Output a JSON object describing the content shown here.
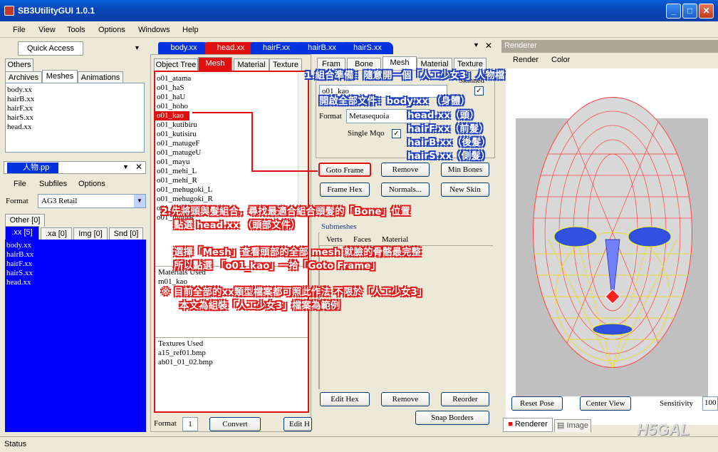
{
  "window": {
    "title": "SB3UtilityGUI 1.0.1",
    "min": "_",
    "max": "□",
    "close": "✕"
  },
  "menu": [
    "File",
    "View",
    "Tools",
    "Options",
    "Windows",
    "Help"
  ],
  "quick_access": {
    "title": "Quick Access",
    "tabs": [
      "Others",
      "Archives",
      "Meshes",
      "Animations"
    ],
    "items": [
      "body.xx",
      "hairB.xx",
      "hairF.xx",
      "hairS.xx",
      "head.xx"
    ]
  },
  "pp": {
    "title": "人物.pp",
    "menu": [
      "File",
      "Subfiles",
      "Options"
    ],
    "format_label": "Format",
    "format_value": "AG3 Retail",
    "tabs": [
      "Other [0]",
      ".xx [5]",
      ".xa [0]",
      "Img [0]",
      "Snd [0]"
    ],
    "items": [
      "body.xx",
      "hairB.xx",
      "hairF.xx",
      "hairS.xx",
      "head.xx"
    ]
  },
  "doc_tabs": [
    "body.xx",
    "head.xx",
    "hairF.xx",
    "hairB.xx",
    "hairS.xx"
  ],
  "editor": {
    "tabs": [
      "Object Tree",
      "Mesh",
      "Material",
      "Texture"
    ],
    "mesh_list": [
      "o01_atama",
      "o01_haS",
      "o01_haU",
      "o01_hoho",
      "o01_kao",
      "o01_kutibiru",
      "o01_kutisiru",
      "o01_matugeF",
      "o01_matugeU",
      "o01_mayu",
      "o01_mehi_L",
      "o01_mehi_R",
      "o01_mehugoki_L",
      "o01_mehugoki_R",
      "o01_mimiL",
      "o01_mimiR"
    ],
    "materials_label": "Materials Used",
    "materials": [
      "m01_kao"
    ],
    "textures_label": "Textures Used",
    "textures": [
      "a15_ref01.bmp",
      "ab01_01_02.bmp"
    ],
    "format_label": "Format",
    "format_value": "1",
    "convert": "Convert",
    "edit_hex": "Edit H"
  },
  "right": {
    "tabs": [
      "Fram",
      "Bone",
      "Mesh",
      "Material",
      "Texture"
    ],
    "name_label": "Name",
    "name_value": "o01_kao",
    "skinned_label": "Skinned",
    "format_label": "Format",
    "format_value": "Metasequoia",
    "single_mqo": "Single Mqo",
    "buttons": [
      "Goto Frame",
      "Remove",
      "Min Bones",
      "Frame Hex",
      "Normals...",
      "New Skin"
    ],
    "submeshes": "Submeshes",
    "cols": [
      "Verts",
      "Faces",
      "Material"
    ],
    "bottom_buttons": [
      "Edit Hex",
      "Remove",
      "Reorder",
      "Snap Borders"
    ]
  },
  "renderer": {
    "title": "Renderer",
    "menu": [
      "Render",
      "Color"
    ],
    "reset": "Reset Pose",
    "center": "Center View",
    "sensitivity": "Sensitivity",
    "sens_value": "100",
    "tabs": [
      "Renderer",
      "Image"
    ]
  },
  "status": "Status",
  "watermark": "H5GAL",
  "annotations": {
    "a1": "1.組合準備：隨意開一個「人工少女3」人物檔",
    "a2": "開啟全部文件：body.xx （身體）",
    "a3": "head.xx（頭）",
    "a4": "hairF.xx（前髮）",
    "a5": "hairB.xx（後髮）",
    "a6": "hairS.xx（側髮）",
    "b1": "2.先將頭與髮組合，尋找最適合組合頭髮的「Bone」位置",
    "b2": "點選 head.xx （頭部文件）",
    "c1": "選擇「Mesh」查看頭部的全部 mesh 就臉的骨骼最完整",
    "c2": "所以點選 「o01_kao」一拾「Goto Frame」",
    "d1": "※ 目前全部的xx類型檔案都可照此作法 不限於「人工少女3」",
    "d2": "本文為組裝「人工少女3」檔案為範例"
  }
}
